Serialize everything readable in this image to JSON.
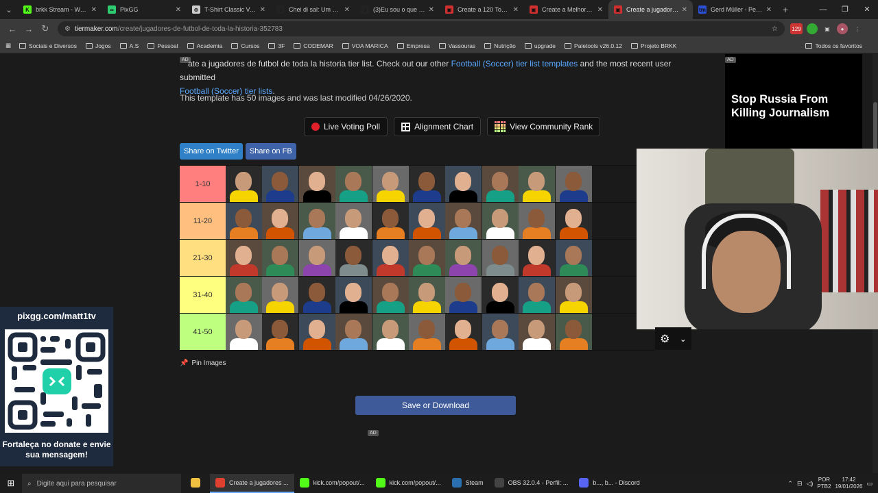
{
  "browser": {
    "tabs": [
      {
        "title": "brkk Stream - Watch",
        "color": "#53fc18",
        "glyph": "K"
      },
      {
        "title": "PixGG",
        "color": "#2ecc71",
        "glyph": "∞"
      },
      {
        "title": "T-Shirt Classic Vectra",
        "color": "#cccccc",
        "glyph": "⊕"
      },
      {
        "title": "Chei di sal: Um Meme",
        "color": "#222222",
        "glyph": "♪"
      },
      {
        "title": "(3)Eu sou o que desm",
        "color": "#222222",
        "glyph": "♪"
      },
      {
        "title": "Create a 120 Top One",
        "color": "#d03030",
        "glyph": "▣"
      },
      {
        "title": "Create a Melhores luz",
        "color": "#d03030",
        "glyph": "▣"
      },
      {
        "title": "Create a jugadores de",
        "color": "#d03030",
        "glyph": "▣",
        "active": true
      },
      {
        "title": "Gerd Müller - Perfil d",
        "color": "#2a4fd0",
        "glyph": "tm"
      }
    ],
    "new_tab": "+",
    "url_domain": "tiermaker.com",
    "url_path": "/create/jugadores-de-futbol-de-toda-la-historia-352783",
    "ext_badge": "129",
    "bookmarks": [
      "Sociais e Diversos",
      "Jogos",
      "A.S",
      "Pessoal",
      "Academia",
      "Cursos",
      "3F",
      "CODEMAR",
      "VOA MARICA",
      "Empresa",
      "Vassouras",
      "Nutrição",
      "upgrade",
      "Paletools v26.0.12",
      "Projeto BRKK"
    ],
    "bookmarks_right": "Todos os favoritos"
  },
  "page": {
    "intro_pre": "ate a jugadores de futbol de toda la historia tier list. Check out our other ",
    "intro_link1": "Football (Soccer) tier list templates",
    "intro_mid": " and the most recent user submitted ",
    "intro_link2": "Football (Soccer) tier lists",
    "intro_end": ".",
    "ad_label": "AD",
    "meta": "This template has 50 images and was last modified 04/26/2020.",
    "buttons": {
      "poll": "Live Voting Poll",
      "chart": "Alignment Chart",
      "rank": "View Community Rank"
    },
    "share": {
      "twitter": "Share on Twitter",
      "fb": "Share on FB"
    },
    "tiers": [
      {
        "label": "1-10",
        "color": "#ff7f7f"
      },
      {
        "label": "11-20",
        "color": "#ffbf7f"
      },
      {
        "label": "21-30",
        "color": "#ffdf7f"
      },
      {
        "label": "31-40",
        "color": "#ffff7f"
      },
      {
        "label": "41-50",
        "color": "#bfff7f"
      }
    ],
    "pin_label": "Pin Images",
    "save_label": "Save or Download",
    "ad_right_headline": "Stop Russia From Killing Journalism"
  },
  "overlay": {
    "qr_url": "pixgg.com/matt1tv",
    "qr_caption": "Fortaleça no donate e envie sua mensagem!"
  },
  "taskbar": {
    "search_placeholder": "Digite aqui para pesquisar",
    "items": [
      {
        "label": "",
        "color": "#f0c040"
      },
      {
        "label": "Create a jugadores ...",
        "color": "#e04030",
        "active": true
      },
      {
        "label": "kick.com/popout/...",
        "color": "#53fc18"
      },
      {
        "label": "kick.com/popout/...",
        "color": "#53fc18"
      },
      {
        "label": "Steam",
        "color": "#2a6fb0"
      },
      {
        "label": "OBS 32.0.4 - Perfil: ...",
        "color": "#444444"
      },
      {
        "label": "b..., b... - Discord",
        "color": "#5865f2"
      }
    ],
    "lang1": "POR",
    "lang2": "PTB2",
    "time": "17:42",
    "date": "19/01/2026"
  }
}
